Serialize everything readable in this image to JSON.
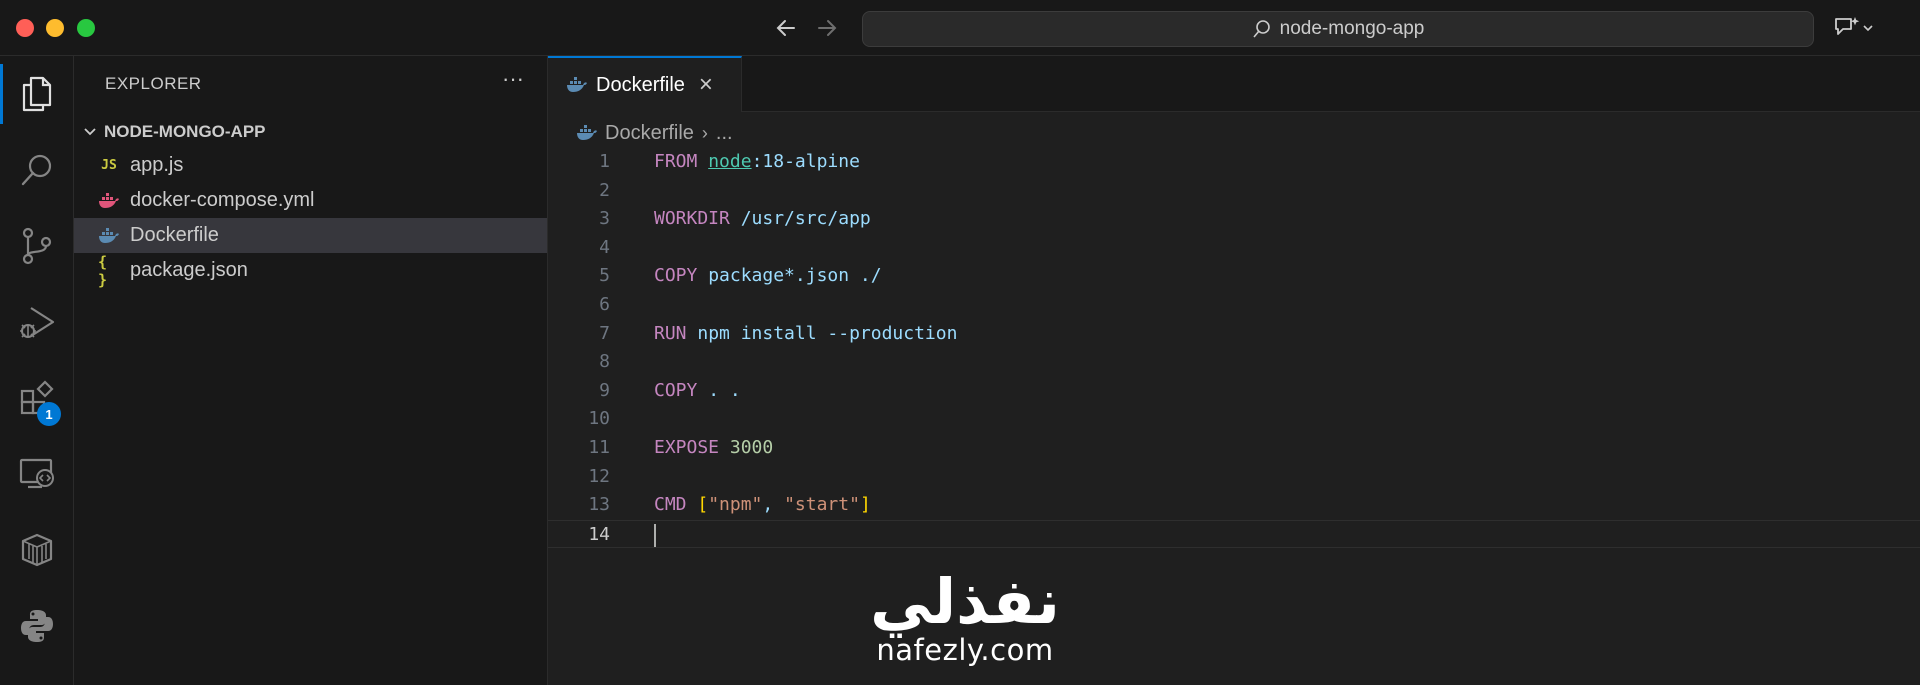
{
  "titlebar": {
    "search_text": "node-mongo-app"
  },
  "activitybar": {
    "items": [
      {
        "name": "explorer-icon",
        "active": true
      },
      {
        "name": "search-icon"
      },
      {
        "name": "source-control-icon"
      },
      {
        "name": "run-debug-icon"
      },
      {
        "name": "extensions-icon",
        "badge": "1"
      },
      {
        "name": "remote-explorer-icon"
      },
      {
        "name": "containers-icon"
      },
      {
        "name": "python-icon"
      }
    ]
  },
  "sidebar": {
    "title": "EXPLORER",
    "more": "···",
    "folder": "NODE-MONGO-APP",
    "files": [
      {
        "label": "app.js",
        "icon": "JS"
      },
      {
        "label": "docker-compose.yml",
        "icon": "docker"
      },
      {
        "label": "Dockerfile",
        "icon": "docker",
        "selected": true
      },
      {
        "label": "package.json",
        "icon": "{ }"
      }
    ]
  },
  "editor": {
    "tab_label": "Dockerfile",
    "tab_close": "×",
    "breadcrumb_file": "Dockerfile",
    "breadcrumb_sep": "›",
    "breadcrumb_more": "...",
    "lines": [
      {
        "n": "1",
        "kw": "FROM",
        "parts": [
          "node",
          ":18-alpine"
        ]
      },
      {
        "n": "2"
      },
      {
        "n": "3",
        "kw": "WORKDIR",
        "text": " /usr/src/app"
      },
      {
        "n": "4"
      },
      {
        "n": "5",
        "kw": "COPY",
        "text": " package*.json ./"
      },
      {
        "n": "6"
      },
      {
        "n": "7",
        "kw": "RUN",
        "text": " npm install --production"
      },
      {
        "n": "8"
      },
      {
        "n": "9",
        "kw": "COPY",
        "text": " . ."
      },
      {
        "n": "10"
      },
      {
        "n": "11",
        "kw": "EXPOSE",
        "num": "3000"
      },
      {
        "n": "12"
      },
      {
        "n": "13",
        "kw": "CMD",
        "cmd": [
          "[",
          "\"npm\"",
          ", ",
          "\"start\"",
          "]"
        ]
      },
      {
        "n": "14",
        "current": true
      }
    ]
  },
  "watermark": {
    "logo": "نفذلي",
    "url": "nafezly.com"
  }
}
